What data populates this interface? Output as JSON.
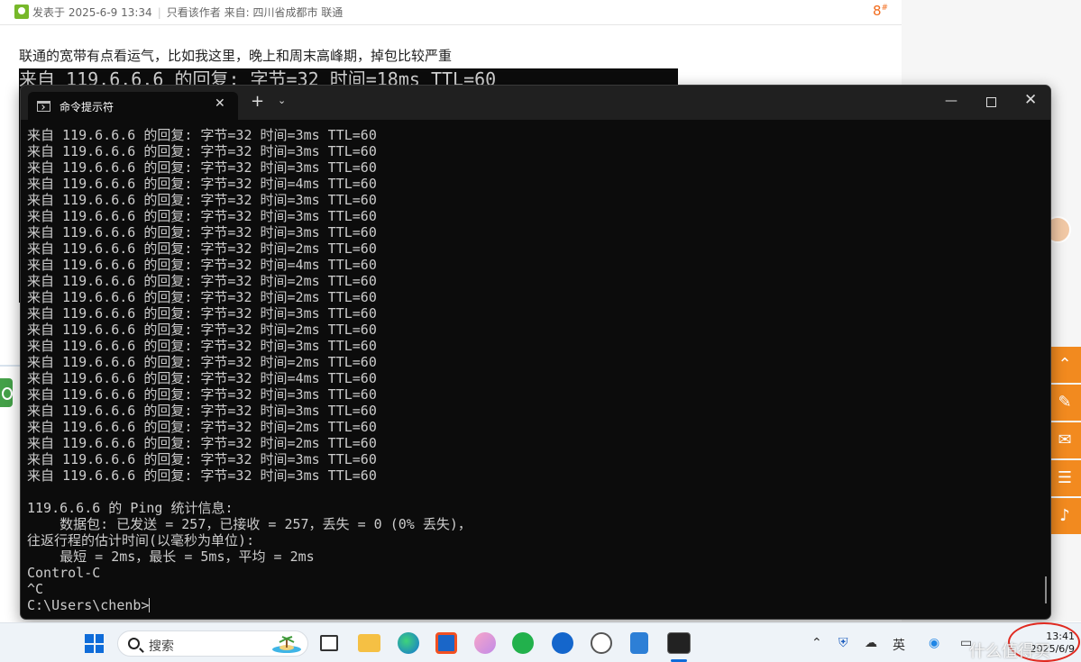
{
  "forum": {
    "post_time": "发表于 2025-6-9 13:34",
    "only_author": "只看该作者",
    "from_label": "来自:",
    "from_location": "四川省成都市 联通",
    "floor": "8",
    "floor_mark": "#",
    "body_text": "联通的宽带有点看运气，比如我这里，晚上和周末高峰期，掉包比较严重",
    "snapshot_line": "来自 119.6.6.6 的回复: 字节=32 时间=18ms TTL=60"
  },
  "terminal": {
    "tab_title": "命令提示符",
    "tab_close": "✕",
    "new_tab": "+",
    "dropdown": "⌄",
    "minimize": "—",
    "close": "✕",
    "reply_lines": [
      "来自 119.6.6.6 的回复: 字节=32 时间=3ms TTL=60",
      "来自 119.6.6.6 的回复: 字节=32 时间=3ms TTL=60",
      "来自 119.6.6.6 的回复: 字节=32 时间=3ms TTL=60",
      "来自 119.6.6.6 的回复: 字节=32 时间=4ms TTL=60",
      "来自 119.6.6.6 的回复: 字节=32 时间=3ms TTL=60",
      "来自 119.6.6.6 的回复: 字节=32 时间=3ms TTL=60",
      "来自 119.6.6.6 的回复: 字节=32 时间=3ms TTL=60",
      "来自 119.6.6.6 的回复: 字节=32 时间=2ms TTL=60",
      "来自 119.6.6.6 的回复: 字节=32 时间=4ms TTL=60",
      "来自 119.6.6.6 的回复: 字节=32 时间=2ms TTL=60",
      "来自 119.6.6.6 的回复: 字节=32 时间=2ms TTL=60",
      "来自 119.6.6.6 的回复: 字节=32 时间=3ms TTL=60",
      "来自 119.6.6.6 的回复: 字节=32 时间=2ms TTL=60",
      "来自 119.6.6.6 的回复: 字节=32 时间=3ms TTL=60",
      "来自 119.6.6.6 的回复: 字节=32 时间=2ms TTL=60",
      "来自 119.6.6.6 的回复: 字节=32 时间=4ms TTL=60",
      "来自 119.6.6.6 的回复: 字节=32 时间=3ms TTL=60",
      "来自 119.6.6.6 的回复: 字节=32 时间=3ms TTL=60",
      "来自 119.6.6.6 的回复: 字节=32 时间=2ms TTL=60",
      "来自 119.6.6.6 的回复: 字节=32 时间=2ms TTL=60",
      "来自 119.6.6.6 的回复: 字节=32 时间=3ms TTL=60",
      "来自 119.6.6.6 的回复: 字节=32 时间=3ms TTL=60"
    ],
    "stats_header": "119.6.6.6 的 Ping 统计信息:",
    "stats_packets": "    数据包: 已发送 = 257，已接收 = 257，丢失 = 0 (0% 丢失)，",
    "stats_rtt_header": "往返行程的估计时间(以毫秒为单位):",
    "stats_rtt": "    最短 = 2ms，最长 = 5ms，平均 = 2ms",
    "ctrl_c": "Control-C",
    "caret_c": "^C",
    "prompt": "C:\\Users\\chenb>"
  },
  "sidebar_icons": [
    "chevron-up-icon",
    "edit-icon",
    "comment-icon",
    "list-icon",
    "bell-icon"
  ],
  "taskbar": {
    "search_label": "搜索",
    "time": "13:41",
    "date": "2025/6/9",
    "apps": [
      "start-icon",
      "search-icon",
      "task-view-icon",
      "file-explorer-icon",
      "edge-icon",
      "store-icon",
      "app-2-icon",
      "wechat-icon",
      "app-blue-icon",
      "clock-app-icon",
      "notepad-icon",
      "terminal-icon"
    ],
    "tray": [
      "chevron-up-icon",
      "shield-icon",
      "cloud-icon",
      "ime-icon",
      "qq-icon",
      "monitor-icon"
    ]
  },
  "watermark": "什么值得买",
  "colors": {
    "accent": "#0f6cd9",
    "orange": "#f28a1f",
    "terminal_bg": "#0c0c0c",
    "terminal_text": "#cccccc",
    "highlight_circle": "#e02a20"
  }
}
